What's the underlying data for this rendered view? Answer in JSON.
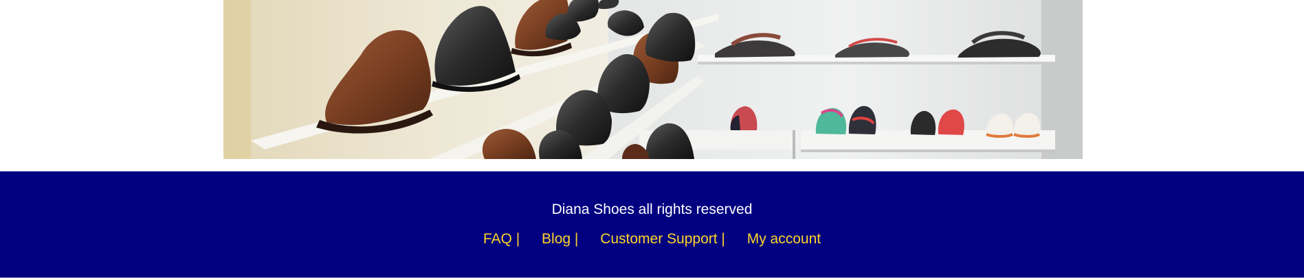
{
  "hero": {
    "image_name": "shoe-store-shelves-photo"
  },
  "footer": {
    "copyright": "Diana Shoes all rights reserved",
    "links": [
      {
        "label": "FAQ |"
      },
      {
        "label": "Blog |"
      },
      {
        "label": "Customer Support |"
      },
      {
        "label": "My account"
      }
    ],
    "colors": {
      "background": "#000080",
      "text": "#ffffff",
      "link": "#ffd42a"
    }
  }
}
